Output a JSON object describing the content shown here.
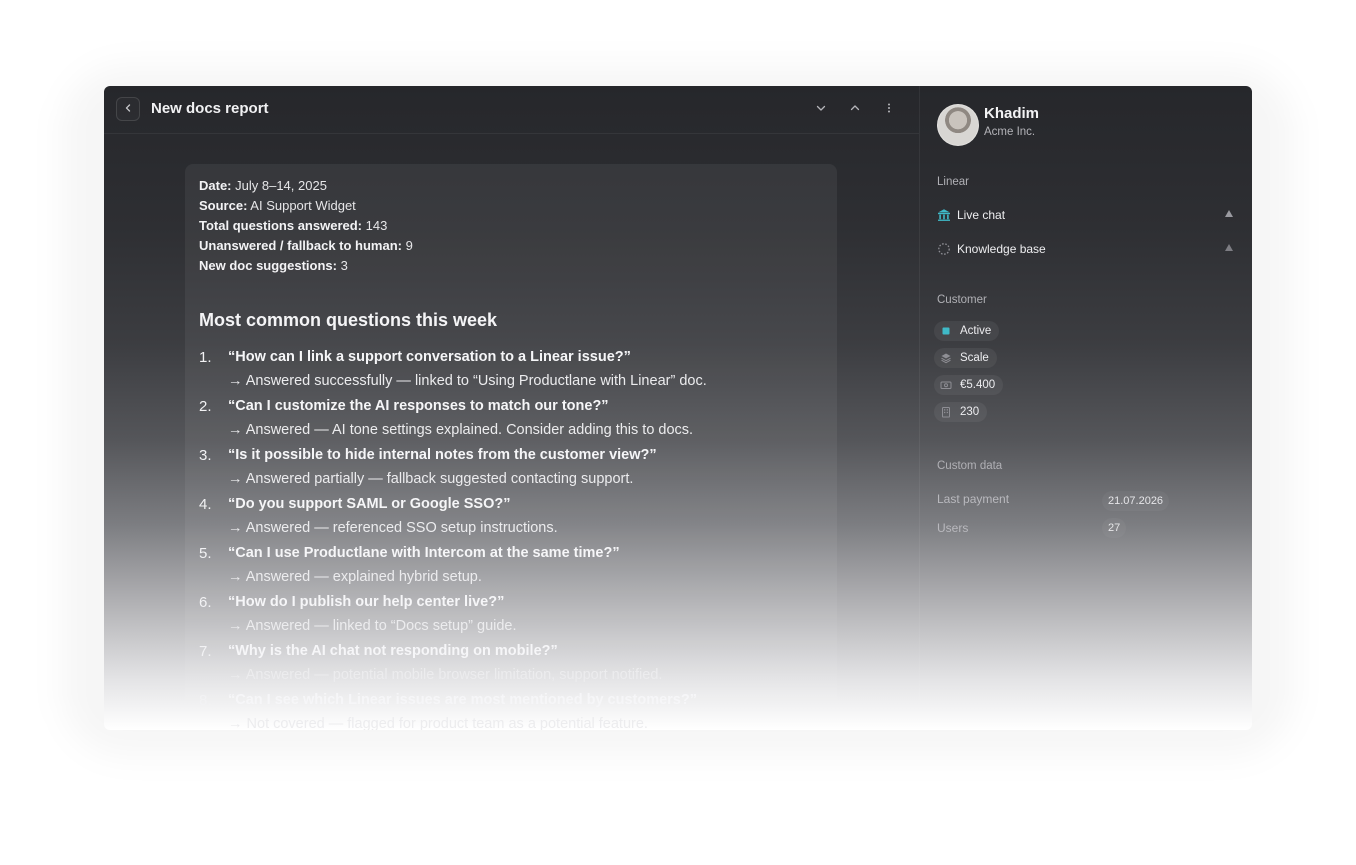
{
  "header": {
    "title": "New docs report"
  },
  "report": {
    "meta": [
      {
        "label": "Date:",
        "value": " July 8–14, 2025"
      },
      {
        "label": "Source:",
        "value": " AI Support Widget"
      },
      {
        "label": "Total questions answered:",
        "value": " 143"
      },
      {
        "label": "Unanswered / fallback to human:",
        "value": " 9"
      },
      {
        "label": "New doc suggestions:",
        "value": " 3"
      }
    ],
    "section_title": "Most common questions this week",
    "questions": [
      {
        "num": "1.",
        "q": "“How can I link a support conversation to a Linear issue?”",
        "a": "→ Answered successfully — linked to “Using Productlane with Linear” doc."
      },
      {
        "num": "2.",
        "q": "“Can I customize the AI responses to match our tone?”",
        "a": "→ Answered — AI tone settings explained. Consider adding this to docs."
      },
      {
        "num": "3.",
        "q": "“Is it possible to hide internal notes from the customer view?”",
        "a": "→ Answered partially — fallback suggested contacting support."
      },
      {
        "num": "4.",
        "q": "“Do you support SAML or Google SSO?”",
        "a": "→ Answered — referenced SSO setup instructions."
      },
      {
        "num": "5.",
        "q": "“Can I use Productlane with Intercom at the same time?”",
        "a": "→ Answered — explained hybrid setup."
      },
      {
        "num": "6.",
        "q": "“How do I publish our help center live?”",
        "a": "→ Answered — linked to “Docs setup” guide."
      },
      {
        "num": "7.",
        "q": "“Why is the AI chat not responding on mobile?”",
        "a": "→ Answered — potential mobile browser limitation, support notified."
      },
      {
        "num": "8.",
        "q": "“Can I see which Linear issues are most mentioned by customers?”",
        "a": "→ Not covered — flagged for product team as a potential feature."
      }
    ]
  },
  "sidebar": {
    "user": {
      "name": "Khadim",
      "org": "Acme Inc."
    },
    "linear": {
      "label": "Linear",
      "items": [
        {
          "label": "Live chat",
          "icon": "bank-icon"
        },
        {
          "label": "Knowledge base",
          "icon": "dashed-circle-icon"
        }
      ]
    },
    "customer": {
      "label": "Customer",
      "status": "Active",
      "plan": "Scale",
      "revenue": "€5.400",
      "employees": "230"
    },
    "custom_data": {
      "label": "Custom data",
      "rows": [
        {
          "key": "Last payment",
          "value": "21.07.2026"
        },
        {
          "key": "Users",
          "value": "27"
        }
      ]
    }
  },
  "colors": {
    "accent_teal": "#3fb9c7"
  }
}
